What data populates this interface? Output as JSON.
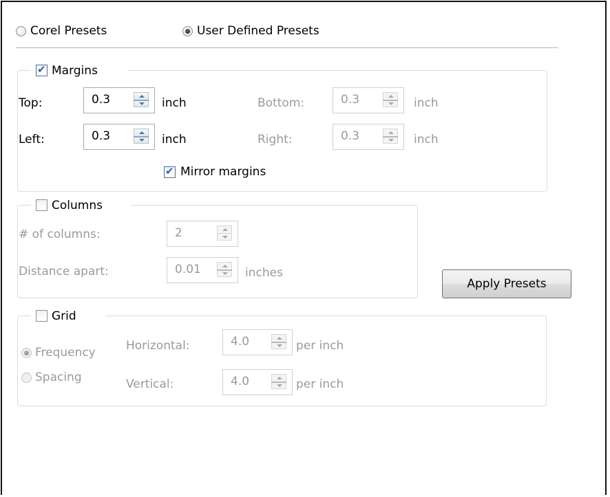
{
  "presets": {
    "corel_label": "Corel Presets",
    "user_label": "User Defined Presets",
    "selected": "user"
  },
  "margins": {
    "legend": "Margins",
    "enabled": true,
    "top_label": "Top:",
    "top_value": "0.3",
    "top_unit": "inch",
    "bottom_label": "Bottom:",
    "bottom_value": "0.3",
    "bottom_unit": "inch",
    "left_label": "Left:",
    "left_value": "0.3",
    "left_unit": "inch",
    "right_label": "Right:",
    "right_value": "0.3",
    "right_unit": "inch",
    "mirror_label": "Mirror margins",
    "mirror_checked": true
  },
  "columns": {
    "legend": "Columns",
    "enabled": false,
    "count_label": "# of columns:",
    "count_value": "2",
    "distance_label": "Distance apart:",
    "distance_value": "0.01",
    "distance_unit": "inches"
  },
  "apply_button": "Apply Presets",
  "grid": {
    "legend": "Grid",
    "enabled": false,
    "frequency_label": "Frequency",
    "spacing_label": "Spacing",
    "selected": "frequency",
    "horizontal_label": "Horizontal:",
    "horizontal_value": "4.0",
    "horizontal_unit": "per inch",
    "vertical_label": "Vertical:",
    "vertical_value": "4.0",
    "vertical_unit": "per inch"
  }
}
